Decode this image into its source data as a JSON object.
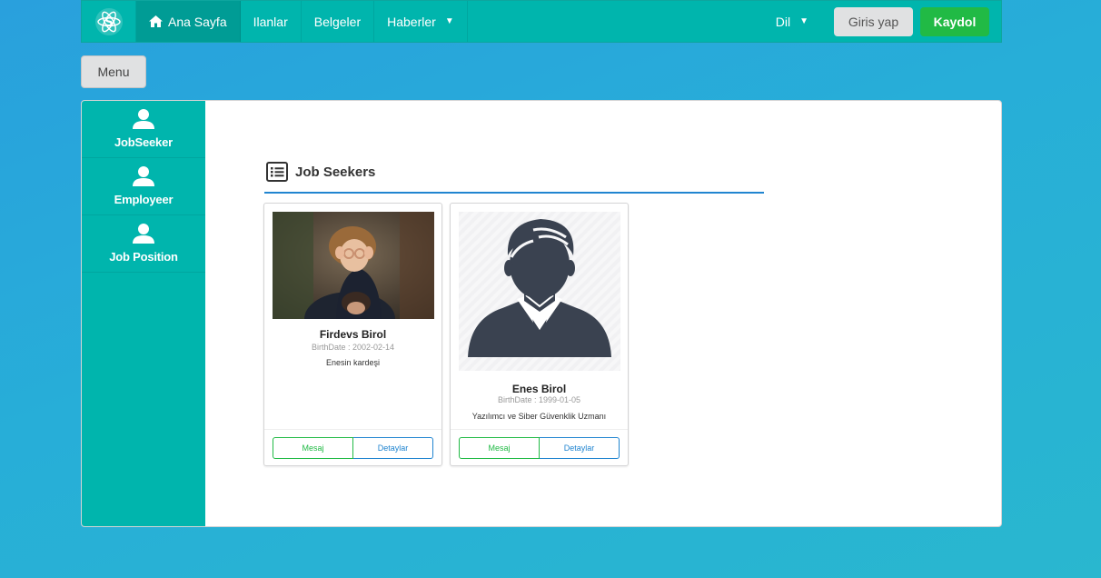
{
  "navbar": {
    "logo_icon": "react-atom-logo-icon",
    "items": [
      {
        "label": "Ana Sayfa",
        "icon": "home-icon",
        "active": true
      },
      {
        "label": "Ilanlar"
      },
      {
        "label": "Belgeler"
      },
      {
        "label": "Haberler",
        "dropdown": true
      }
    ],
    "language_label": "Dil",
    "login_label": "Giris yap",
    "register_label": "Kaydol",
    "colors": {
      "bar": "#00b5ad",
      "register": "#21ba45",
      "login": "#e0e1e2"
    }
  },
  "menu_button_label": "Menu",
  "sidebar": {
    "items": [
      {
        "label": "JobSeeker",
        "icon": "user-icon"
      },
      {
        "label": "Employeer",
        "icon": "user-icon"
      },
      {
        "label": "Job Position",
        "icon": "user-icon"
      }
    ]
  },
  "main": {
    "header_icon": "list-icon",
    "header_title": "Job Seekers",
    "cards": [
      {
        "image": "child-photo",
        "name": "Firdevs Birol",
        "birth": "BirthDate : 2002-02-14",
        "description": "Enesin kardeşi",
        "message_label": "Mesaj",
        "details_label": "Detaylar"
      },
      {
        "image": "avatar-placeholder",
        "name": "Enes Birol",
        "birth": "BirthDate : 1999-01-05",
        "description": "Yazılımcı ve Siber Güvenklik Uzmanı",
        "message_label": "Mesaj",
        "details_label": "Detaylar"
      }
    ]
  }
}
